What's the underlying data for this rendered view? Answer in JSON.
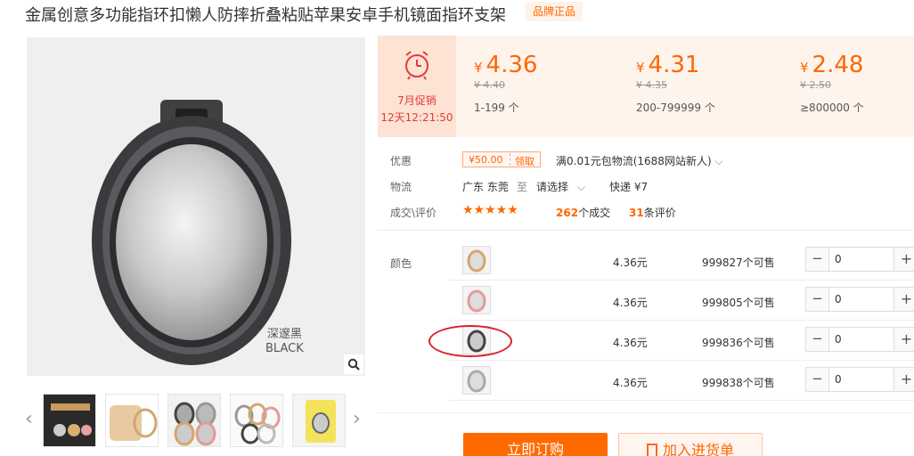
{
  "product": {
    "title": "金属创意多功能指环扣懒人防摔折叠粘贴苹果安卓手机镜面指环支架",
    "badge": "品牌正品"
  },
  "gallery": {
    "color_text_cn": "深邃黑",
    "color_text_en": "BLACK",
    "thumbnails": [
      "thumb-1",
      "thumb-2",
      "thumb-3",
      "thumb-4",
      "thumb-5"
    ]
  },
  "promo": {
    "label": "7月促销",
    "countdown": "12天12:21:50"
  },
  "price_tiers": [
    {
      "currency": "¥",
      "price": "4.36",
      "old_price": "¥ 4.40",
      "quantity": "1-199 个"
    },
    {
      "currency": "¥",
      "price": "4.31",
      "old_price": "¥ 4.35",
      "quantity": "200-799999 个"
    },
    {
      "currency": "¥",
      "price": "2.48",
      "old_price": "¥ 2.50",
      "quantity": "≥800000 个"
    }
  ],
  "discount": {
    "label": "优惠",
    "coupon_amount": "¥50.00",
    "coupon_action": "领取",
    "text": "满0.01元包物流(1688网站新人)"
  },
  "shipping": {
    "label": "物流",
    "origin": "广东 东莞",
    "to": "至",
    "destination": "请选择",
    "method": "快递 ¥7"
  },
  "reviews": {
    "label": "成交\\评价",
    "stars": "★★★★★",
    "deals_count": "262",
    "deals_label": "个成交",
    "review_count": "31",
    "review_label": "条评价"
  },
  "sku": {
    "label": "颜色",
    "rows": [
      {
        "price": "4.36元",
        "stock": "999827个可售",
        "qty": "0"
      },
      {
        "price": "4.36元",
        "stock": "999805个可售",
        "qty": "0"
      },
      {
        "price": "4.36元",
        "stock": "999836个可售",
        "qty": "0"
      },
      {
        "price": "4.36元",
        "stock": "999838个可售",
        "qty": "0"
      }
    ]
  },
  "actions": {
    "order": "立即订购",
    "cart": "加入进货单"
  },
  "colors": {
    "accent": "#ff6a00",
    "promo_red": "#e4393c"
  }
}
